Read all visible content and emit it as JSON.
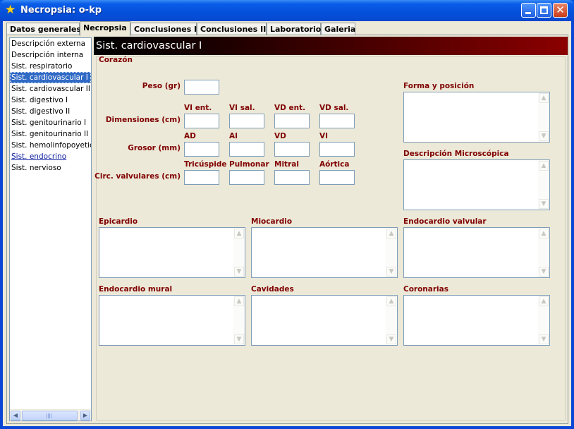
{
  "window": {
    "title": "Necropsia: o-kp",
    "icon": "star-icon",
    "minimize_glyph": "",
    "maximize_glyph": "",
    "close_glyph": "✕"
  },
  "tabs": [
    {
      "label": "Datos generales"
    },
    {
      "label": "Necropsia"
    },
    {
      "label": "Conclusiones I"
    },
    {
      "label": "Conclusiones II"
    },
    {
      "label": "Laboratorio"
    },
    {
      "label": "Galeria"
    }
  ],
  "active_tab": "Necropsia",
  "nav": {
    "items": [
      {
        "label": "Descripción externa"
      },
      {
        "label": "Descripción interna"
      },
      {
        "label": "Sist. respiratorio"
      },
      {
        "label": "Sist. cardiovascular I"
      },
      {
        "label": "Sist. cardiovascular II"
      },
      {
        "label": "Sist. digestivo I"
      },
      {
        "label": "Sist. digestivo II"
      },
      {
        "label": "Sist. genitourinario I"
      },
      {
        "label": "Sist. genitourinario II"
      },
      {
        "label": "Sist. hemolinfopoyetico"
      },
      {
        "label": "Sist. endocrino"
      },
      {
        "label": "Sist. nervioso"
      }
    ],
    "selected": "Sist. cardiovascular I",
    "scroll_left": "◀",
    "scroll_right": "▶"
  },
  "section": {
    "header": "Sist. cardiovascular I",
    "group": "Corazón",
    "peso_label": "Peso (gr)",
    "dimensiones_label": "Dimensiones (cm)",
    "grosor_label": "Grosor (mm)",
    "circ_label": "Circ. valvulares (cm)",
    "dim_cols": [
      "VI ent.",
      "VI sal.",
      "VD ent.",
      "VD sal."
    ],
    "grosor_cols": [
      "AD",
      "AI",
      "VD",
      "VI"
    ],
    "circ_cols": [
      "Tricúspide",
      "Pulmonar",
      "Mitral",
      "Aórtica"
    ]
  },
  "memos": {
    "forma": "Forma y posición",
    "microscopica": "Descripción Microscópica",
    "epicardio": "Epicardio",
    "miocardio": "Miocardio",
    "endocardio_valvular": "Endocardio valvular",
    "endocardio_mural": "Endocardio mural",
    "cavidades": "Cavidades",
    "coronarias": "Coronarias",
    "up_arrow": "▲",
    "down_arrow": "▼"
  }
}
